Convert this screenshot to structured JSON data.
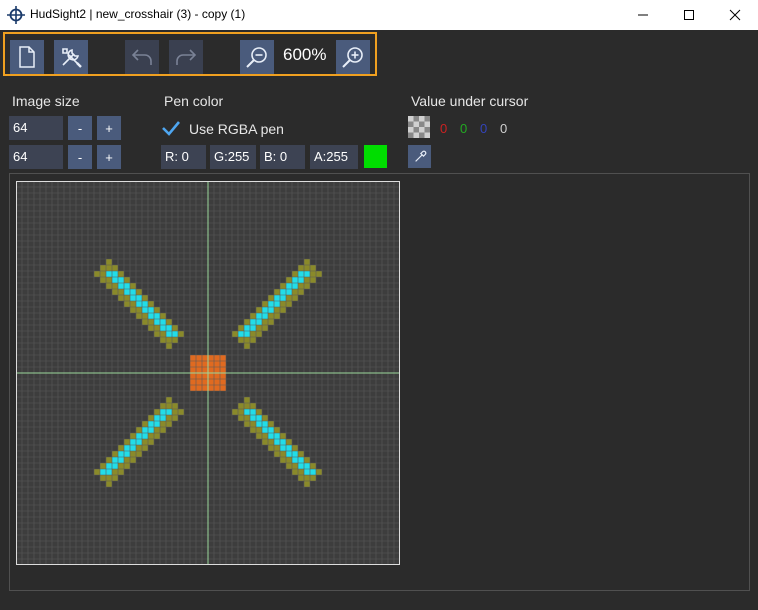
{
  "window": {
    "title": "HudSight2 | new_crosshair (3) - copy (1)",
    "minimize_icon": "minimize-icon",
    "maximize_icon": "maximize-icon",
    "close_icon": "close-icon"
  },
  "toolbar": {
    "buttons": [
      {
        "name": "new-file-button",
        "icon": "new-file-icon",
        "enabled": true
      },
      {
        "name": "tools-button",
        "icon": "tools-icon",
        "enabled": true
      },
      {
        "name": "undo-button",
        "icon": "undo-icon",
        "enabled": false
      },
      {
        "name": "redo-button",
        "icon": "redo-icon",
        "enabled": false
      },
      {
        "name": "zoom-out-button",
        "icon": "zoom-out-icon",
        "enabled": true
      },
      {
        "name": "zoom-in-button",
        "icon": "zoom-in-icon",
        "enabled": true
      }
    ],
    "zoom": "600%",
    "highlight_color": "#f0a020"
  },
  "image_size": {
    "label": "Image size",
    "width": "64",
    "height": "64",
    "minus": "-",
    "plus": "+"
  },
  "pen": {
    "label": "Pen color",
    "use_rgba_label": "Use RGBA pen",
    "use_rgba_checked": true,
    "r": "R:  0",
    "g": "G:255",
    "b": "B:  0",
    "a": "A:255",
    "swatch_color": "#00dd00"
  },
  "cursor": {
    "label": "Value under cursor",
    "r": "0",
    "g": "0",
    "b": "0",
    "a": "0",
    "r_color": "#cc2222",
    "g_color": "#22aa22",
    "b_color": "#3344bb",
    "a_color": "#d0d0d0"
  },
  "canvas": {
    "grid_size": 64,
    "zoom_percent": 600,
    "colors": {
      "background": "#3d3d3d",
      "grid": "#5a5a5a",
      "center_line": "#9ad89a",
      "cyan": "#22dde8",
      "olive": "#8a8a2a",
      "orange": "#e06a20"
    }
  }
}
